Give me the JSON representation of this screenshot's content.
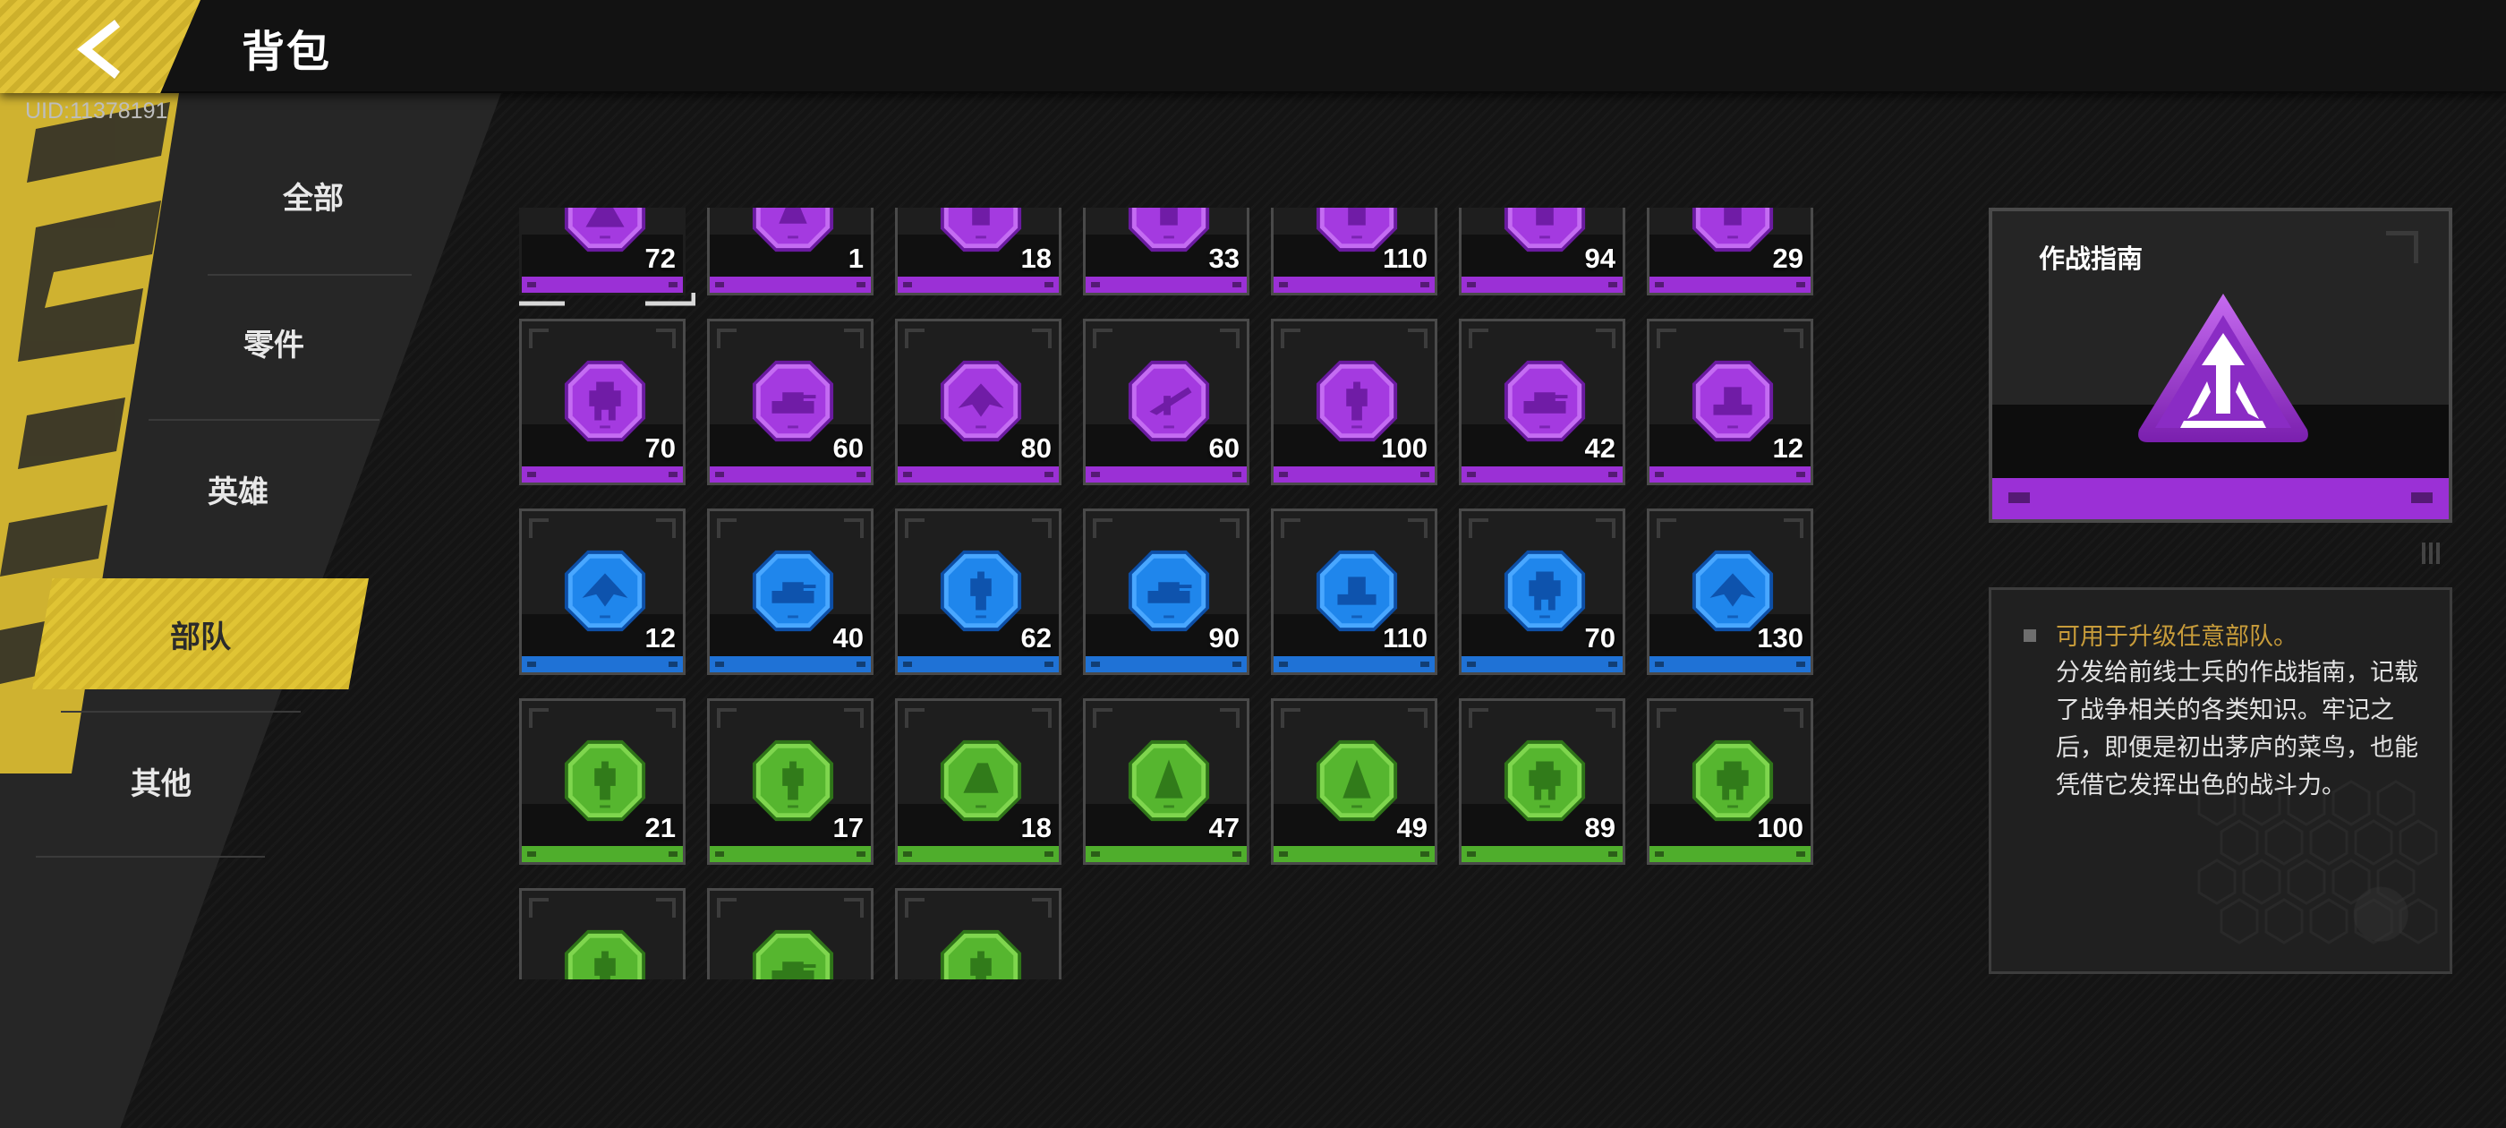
{
  "header": {
    "title": "背包",
    "uid": "UID:11378191"
  },
  "nav": {
    "items": [
      {
        "label": "全部"
      },
      {
        "label": "零件"
      },
      {
        "label": "英雄"
      },
      {
        "label": "部队"
      },
      {
        "label": "其他"
      }
    ],
    "active": "部队"
  },
  "colors": {
    "purple": "#9b30d6",
    "blue": "#1f72d6",
    "green": "#4fae2c",
    "accent": "#d7bb30",
    "highlight_text": "#c89c3a"
  },
  "inventory": {
    "rows": [
      {
        "rarity": "purple",
        "partial": true,
        "items": [
          {
            "qty": "72",
            "icon": "commander-guide-icon"
          },
          {
            "qty": "1",
            "icon": "purple-flask-icon"
          },
          {
            "qty": "18",
            "icon": "unit-badge-icon"
          },
          {
            "qty": "33",
            "icon": "unit-badge-icon"
          },
          {
            "qty": "110",
            "icon": "unit-badge-icon"
          },
          {
            "qty": "94",
            "icon": "unit-badge-icon"
          },
          {
            "qty": "29",
            "icon": "unit-badge-icon"
          }
        ]
      },
      {
        "rarity": "purple",
        "items": [
          {
            "qty": "70",
            "icon": "mech-icon"
          },
          {
            "qty": "60",
            "icon": "tank-icon"
          },
          {
            "qty": "80",
            "icon": "jet-icon"
          },
          {
            "qty": "60",
            "icon": "sniper-icon"
          },
          {
            "qty": "100",
            "icon": "soldier-icon"
          },
          {
            "qty": "42",
            "icon": "tank-icon"
          },
          {
            "qty": "12",
            "icon": "artillery-icon"
          }
        ]
      },
      {
        "rarity": "blue",
        "items": [
          {
            "qty": "12",
            "icon": "jet-icon"
          },
          {
            "qty": "40",
            "icon": "tank-icon"
          },
          {
            "qty": "62",
            "icon": "soldier-icon"
          },
          {
            "qty": "90",
            "icon": "tank-icon"
          },
          {
            "qty": "110",
            "icon": "artillery-icon"
          },
          {
            "qty": "70",
            "icon": "mech-icon"
          },
          {
            "qty": "130",
            "icon": "jet-icon"
          }
        ]
      },
      {
        "rarity": "green",
        "items": [
          {
            "qty": "21",
            "icon": "soldier-icon"
          },
          {
            "qty": "17",
            "icon": "soldier-icon"
          },
          {
            "qty": "18",
            "icon": "scout-icon"
          },
          {
            "qty": "47",
            "icon": "cloak-icon"
          },
          {
            "qty": "49",
            "icon": "cloak-icon"
          },
          {
            "qty": "89",
            "icon": "mech-icon"
          },
          {
            "qty": "100",
            "icon": "mech-icon"
          }
        ]
      },
      {
        "rarity": "green",
        "partial": true,
        "items": [
          {
            "qty": "",
            "icon": "soldier-icon"
          },
          {
            "qty": "",
            "icon": "tank-icon"
          },
          {
            "qty": "",
            "icon": "soldier-icon"
          }
        ]
      }
    ]
  },
  "detail": {
    "title": "作战指南",
    "icon": "commander-guide-icon",
    "rarity": "purple",
    "highlight": "可用于升级任意部队。",
    "description": "分发给前线士兵的作战指南，记载了战争相关的各类知识。牢记之后，即便是初出茅庐的菜鸟，也能凭借它发挥出色的战斗力。"
  }
}
